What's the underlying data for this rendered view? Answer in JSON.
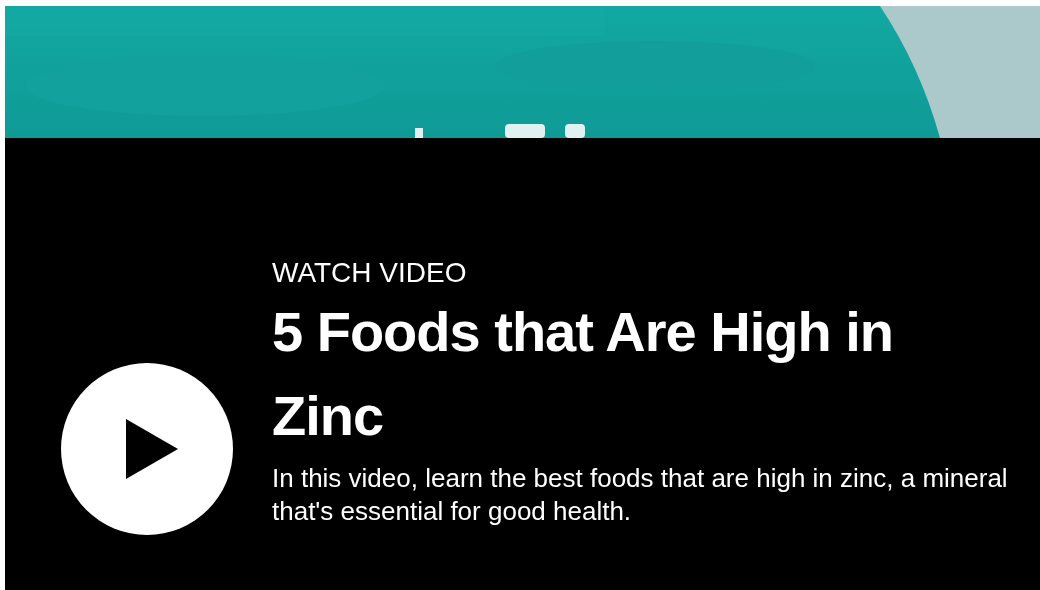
{
  "overlay": {
    "eyebrow": "WATCH VIDEO",
    "title": "5 Foods that Are High in Zinc",
    "description": "In this video, learn the best foods that are high in zinc, a mineral that's essential for good health."
  }
}
